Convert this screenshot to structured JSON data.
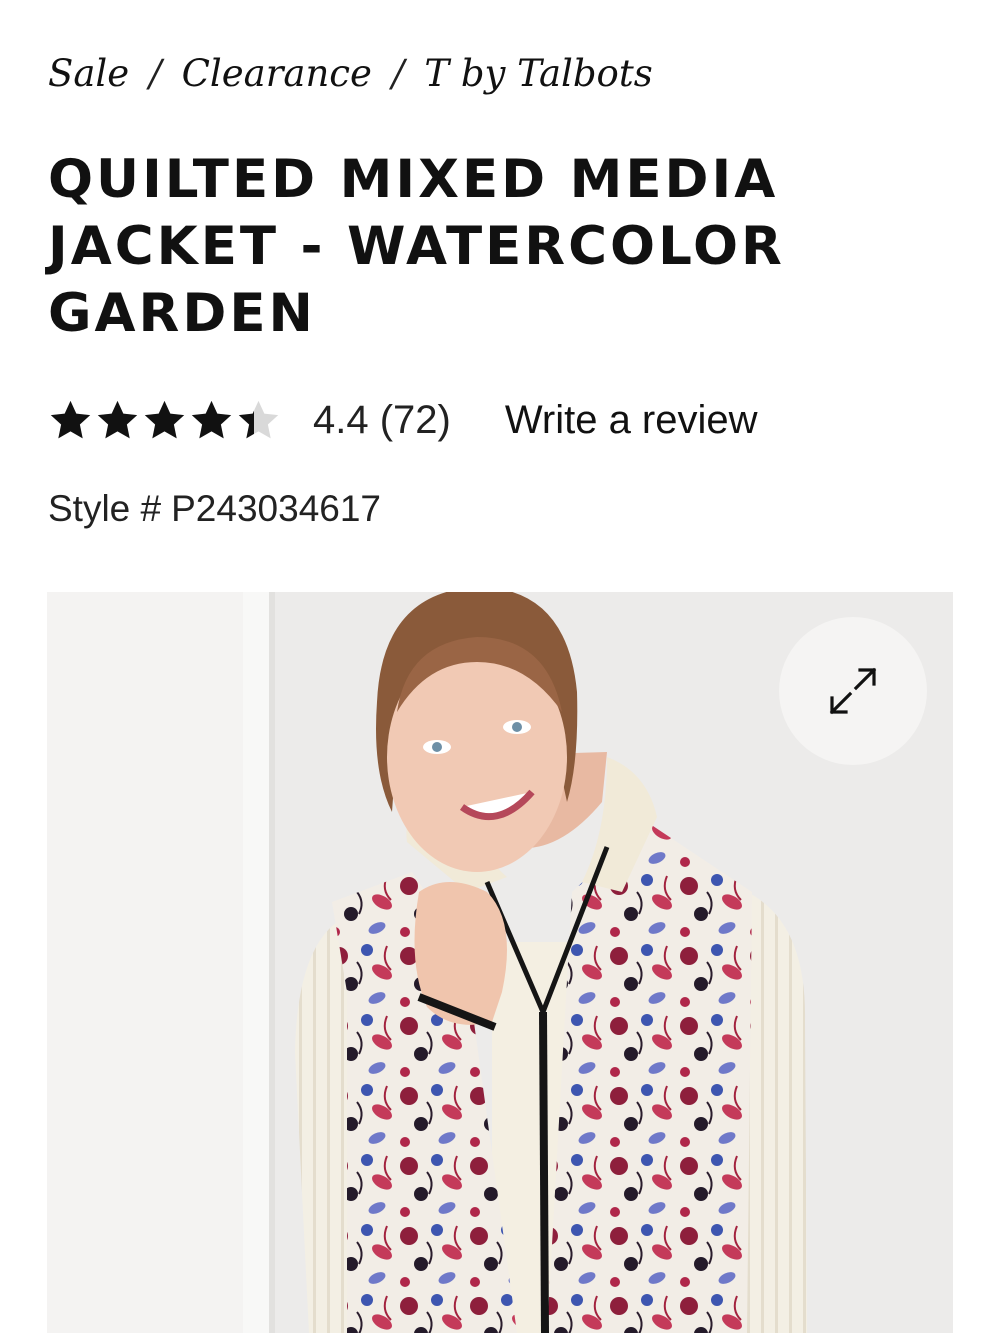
{
  "breadcrumb": [
    "Sale",
    "Clearance",
    "T by Talbots"
  ],
  "product": {
    "title": "QUILTED MIXED MEDIA JACKET - WATERCOLOR GARDEN",
    "rating_value": 4.4,
    "rating_text": "4.4 (72)",
    "write_review_label": "Write a review",
    "style_label": "Style #",
    "style_number": "P243034617"
  },
  "image": {
    "expand_icon": "expand-arrows-icon",
    "alt": "Model wearing floral quilted vest jacket over cream ribbed sweater"
  },
  "colors": {
    "text": "#111111",
    "star_filled": "#111111",
    "star_empty": "#d9d9d9",
    "photo_bg": "#ecebea"
  }
}
